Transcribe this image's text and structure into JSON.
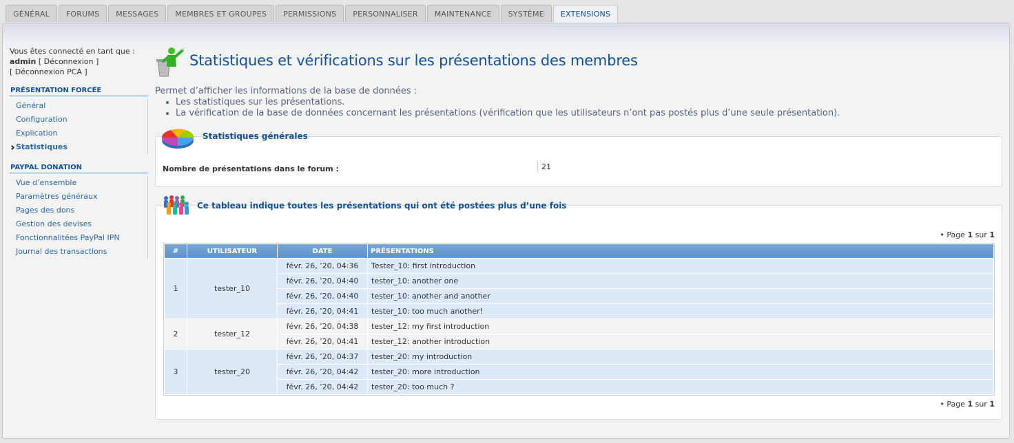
{
  "tabs": [
    {
      "label": "GÉNÉRAL",
      "active": false
    },
    {
      "label": "FORUMS",
      "active": false
    },
    {
      "label": "MESSAGES",
      "active": false
    },
    {
      "label": "MEMBRES ET GROUPES",
      "active": false
    },
    {
      "label": "PERMISSIONS",
      "active": false
    },
    {
      "label": "PERSONNALISER",
      "active": false
    },
    {
      "label": "MAINTENANCE",
      "active": false
    },
    {
      "label": "SYSTÈME",
      "active": false
    },
    {
      "label": "EXTENSIONS",
      "active": true
    }
  ],
  "sidebar": {
    "logged_in_text": "Vous êtes connecté en tant que :",
    "username": "admin",
    "logout_link": "[ Déconnexion ]",
    "logout_acp_link": "[ Déconnexion PCA ]",
    "sections": [
      {
        "title": "PRÉSENTATION FORCÉE",
        "items": [
          {
            "label": "Général",
            "current": false
          },
          {
            "label": "Configuration",
            "current": false
          },
          {
            "label": "Explication",
            "current": false
          },
          {
            "label": "Statistiques",
            "current": true
          }
        ]
      },
      {
        "title": "PAYPAL DONATION",
        "items": [
          {
            "label": "Vue d’ensemble",
            "current": false
          },
          {
            "label": "Paramètres généraux",
            "current": false
          },
          {
            "label": "Pages des dons",
            "current": false
          },
          {
            "label": "Gestion des devises",
            "current": false
          },
          {
            "label": "Fonctionnalitées PayPal IPN",
            "current": false
          },
          {
            "label": "Journal des transactions",
            "current": false
          }
        ]
      }
    ]
  },
  "main": {
    "title": "Statistiques et vérifications sur les présentations des membres",
    "title_icon": "teacher-podium-icon",
    "intro": "Permet d’afficher les informations de la base de données :",
    "bullets": [
      "Les statistiques sur les présentations.",
      "La vérification de la base de données concernant les présentations (vérification que les utilisateurs n’ont pas postés plus d’une seule présentation)."
    ],
    "stats_box": {
      "legend": "Statistiques générales",
      "icon": "pie-chart-icon",
      "label": "Nombre de présentations dans le forum :",
      "value": "21"
    },
    "dup_box": {
      "legend": "Ce tableau indique toutes les présentations qui ont été postées plus d’une fois",
      "icon": "group-people-icon",
      "pagination": {
        "prefix": "• Page",
        "current": "1",
        "sep": "sur",
        "total": "1"
      },
      "columns": [
        "#",
        "UTILISATEUR",
        "DATE",
        "PRÉSENTATIONS"
      ],
      "groups": [
        {
          "num": "1",
          "user": "tester_10",
          "rows": [
            {
              "date": "févr. 26, ’20, 04:36",
              "title": "Tester_10: first introduction"
            },
            {
              "date": "févr. 26, ’20, 04:40",
              "title": "tester_10: another one"
            },
            {
              "date": "févr. 26, ’20, 04:40",
              "title": "tester_10: another and another"
            },
            {
              "date": "févr. 26, ’20, 04:41",
              "title": "tester_10: too much another!"
            }
          ]
        },
        {
          "num": "2",
          "user": "tester_12",
          "rows": [
            {
              "date": "févr. 26, ’20, 04:38",
              "title": "tester_12: my first introduction"
            },
            {
              "date": "févr. 26, ’20, 04:41",
              "title": "tester_12: another introduction"
            }
          ]
        },
        {
          "num": "3",
          "user": "tester_20",
          "rows": [
            {
              "date": "févr. 26, ’20, 04:37",
              "title": "tester_20: my introduction"
            },
            {
              "date": "févr. 26, ’20, 04:42",
              "title": "tester_20: more introduction"
            },
            {
              "date": "févr. 26, ’20, 04:42",
              "title": "tester_20: too much ?"
            }
          ]
        }
      ]
    }
  }
}
